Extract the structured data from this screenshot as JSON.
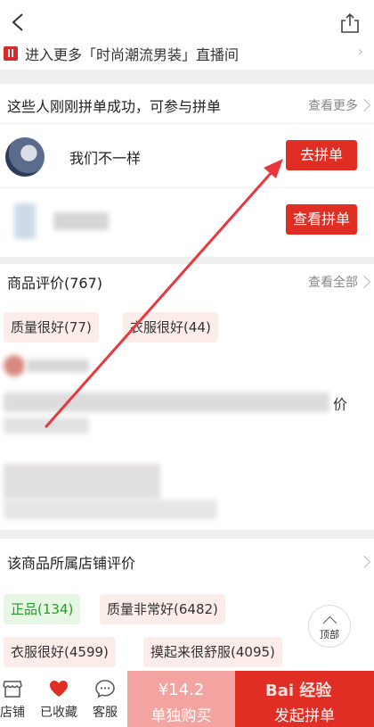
{
  "header": {
    "back_icon": "chevron-left-icon",
    "share_icon": "share-icon"
  },
  "banner": {
    "text": "进入更多「时尚潮流男装」直播间"
  },
  "group_buy": {
    "title": "这些人刚刚拼单成功，可参与拼单",
    "more": "查看更多",
    "rows": [
      {
        "name": "我们不一样",
        "button": "去拼单"
      },
      {
        "name": "",
        "button": "查看拼单"
      }
    ]
  },
  "reviews": {
    "title": "商品评价(767)",
    "more": "查看全部",
    "tags": [
      "质量很好(77)",
      "衣服很好(44)"
    ],
    "trailing_char": "价"
  },
  "store_reviews": {
    "title": "该商品所属店铺评价",
    "tags": [
      "正品(134)",
      "质量非常好(6482)",
      "衣服很好(4599)",
      "摸起来很舒服(4095)"
    ]
  },
  "back_to_top": {
    "label": "顶部"
  },
  "bottom_bar": {
    "items": [
      {
        "label": "店铺",
        "icon": "store-icon"
      },
      {
        "label": "已收藏",
        "icon": "heart-icon"
      },
      {
        "label": "客服",
        "icon": "chat-icon"
      }
    ],
    "buy_alone": {
      "price": "¥14.2",
      "label": "单独购买"
    },
    "buy_group": {
      "label": "发起拼单"
    },
    "watermark": "Bai 经验"
  },
  "colors": {
    "accent": "#e02e24",
    "arrow": "#e8383d",
    "tag_bg": "#fcecea",
    "green_tag": "#2a9a2a"
  }
}
